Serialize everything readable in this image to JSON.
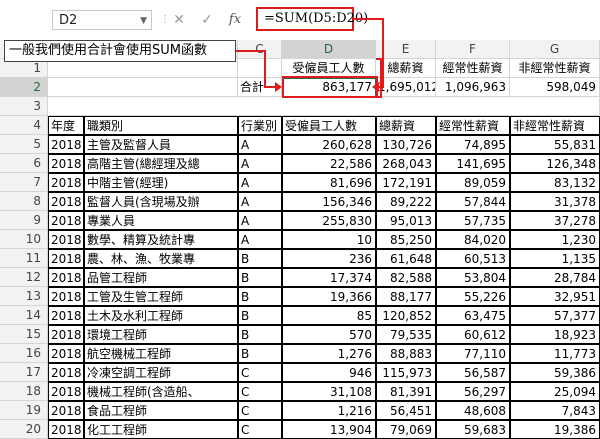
{
  "namebox": {
    "value": "D2"
  },
  "formula": {
    "value": "=SUM(D5:D20)"
  },
  "callout": {
    "text": "一般我們使用合計會使用SUM函數"
  },
  "columns": [
    "C",
    "D",
    "E",
    "F",
    "G"
  ],
  "header_row1": {
    "D": "受僱員工人數",
    "E": "總薪資",
    "F": "經常性薪資",
    "G": "非經常性薪資"
  },
  "total_row": {
    "label": "合計",
    "D": "863,177",
    "E": "1,695,012",
    "F": "1,096,963",
    "G": "598,049"
  },
  "table_headers": {
    "A": "年度",
    "B": "職類別",
    "C": "行業別",
    "D": "受僱員工人數",
    "E": "總薪資",
    "F": "經常性薪資",
    "G": "非經常性薪資"
  },
  "rows": [
    {
      "num": "5",
      "year": "2018",
      "job": "主管及監督人員",
      "ind": "A",
      "emp": "260,628",
      "total": "130,726",
      "reg": "74,895",
      "nonreg": "55,831"
    },
    {
      "num": "6",
      "year": "2018",
      "job": "高階主管(總經理及總",
      "ind": "A",
      "emp": "22,586",
      "total": "268,043",
      "reg": "141,695",
      "nonreg": "126,348"
    },
    {
      "num": "7",
      "year": "2018",
      "job": "中階主管(經理)",
      "ind": "A",
      "emp": "81,696",
      "total": "172,191",
      "reg": "89,059",
      "nonreg": "83,132"
    },
    {
      "num": "8",
      "year": "2018",
      "job": "監督人員(含現場及辦",
      "ind": "A",
      "emp": "156,346",
      "total": "89,222",
      "reg": "57,844",
      "nonreg": "31,378"
    },
    {
      "num": "9",
      "year": "2018",
      "job": "專業人員",
      "ind": "A",
      "emp": "255,830",
      "total": "95,013",
      "reg": "57,735",
      "nonreg": "37,278"
    },
    {
      "num": "10",
      "year": "2018",
      "job": "數學、精算及統計專",
      "ind": "A",
      "emp": "10",
      "total": "85,250",
      "reg": "84,020",
      "nonreg": "1,230"
    },
    {
      "num": "11",
      "year": "2018",
      "job": "農、林、漁、牧業專",
      "ind": "B",
      "emp": "236",
      "total": "61,648",
      "reg": "60,513",
      "nonreg": "1,135"
    },
    {
      "num": "12",
      "year": "2018",
      "job": "品管工程師",
      "ind": "B",
      "emp": "17,374",
      "total": "82,588",
      "reg": "53,804",
      "nonreg": "28,784"
    },
    {
      "num": "13",
      "year": "2018",
      "job": "工管及生管工程師",
      "ind": "B",
      "emp": "19,366",
      "total": "88,177",
      "reg": "55,226",
      "nonreg": "32,951"
    },
    {
      "num": "14",
      "year": "2018",
      "job": "土木及水利工程師",
      "ind": "B",
      "emp": "85",
      "total": "120,852",
      "reg": "63,475",
      "nonreg": "57,377"
    },
    {
      "num": "15",
      "year": "2018",
      "job": "環境工程師",
      "ind": "B",
      "emp": "570",
      "total": "79,535",
      "reg": "60,612",
      "nonreg": "18,923"
    },
    {
      "num": "16",
      "year": "2018",
      "job": "航空機械工程師",
      "ind": "B",
      "emp": "1,276",
      "total": "88,883",
      "reg": "77,110",
      "nonreg": "11,773"
    },
    {
      "num": "17",
      "year": "2018",
      "job": "冷凍空調工程師",
      "ind": "C",
      "emp": "946",
      "total": "115,973",
      "reg": "56,587",
      "nonreg": "59,386"
    },
    {
      "num": "18",
      "year": "2018",
      "job": "機械工程師(含造船、",
      "ind": "C",
      "emp": "31,108",
      "total": "81,391",
      "reg": "56,297",
      "nonreg": "25,094"
    },
    {
      "num": "19",
      "year": "2018",
      "job": "食品工程師",
      "ind": "C",
      "emp": "1,216",
      "total": "56,451",
      "reg": "48,608",
      "nonreg": "7,843"
    },
    {
      "num": "20",
      "year": "2018",
      "job": "化工工程師",
      "ind": "C",
      "emp": "13,904",
      "total": "79,069",
      "reg": "59,683",
      "nonreg": "19,386"
    }
  ],
  "colors": {
    "highlight": "#e01b1b",
    "selection": "#1e7145"
  }
}
